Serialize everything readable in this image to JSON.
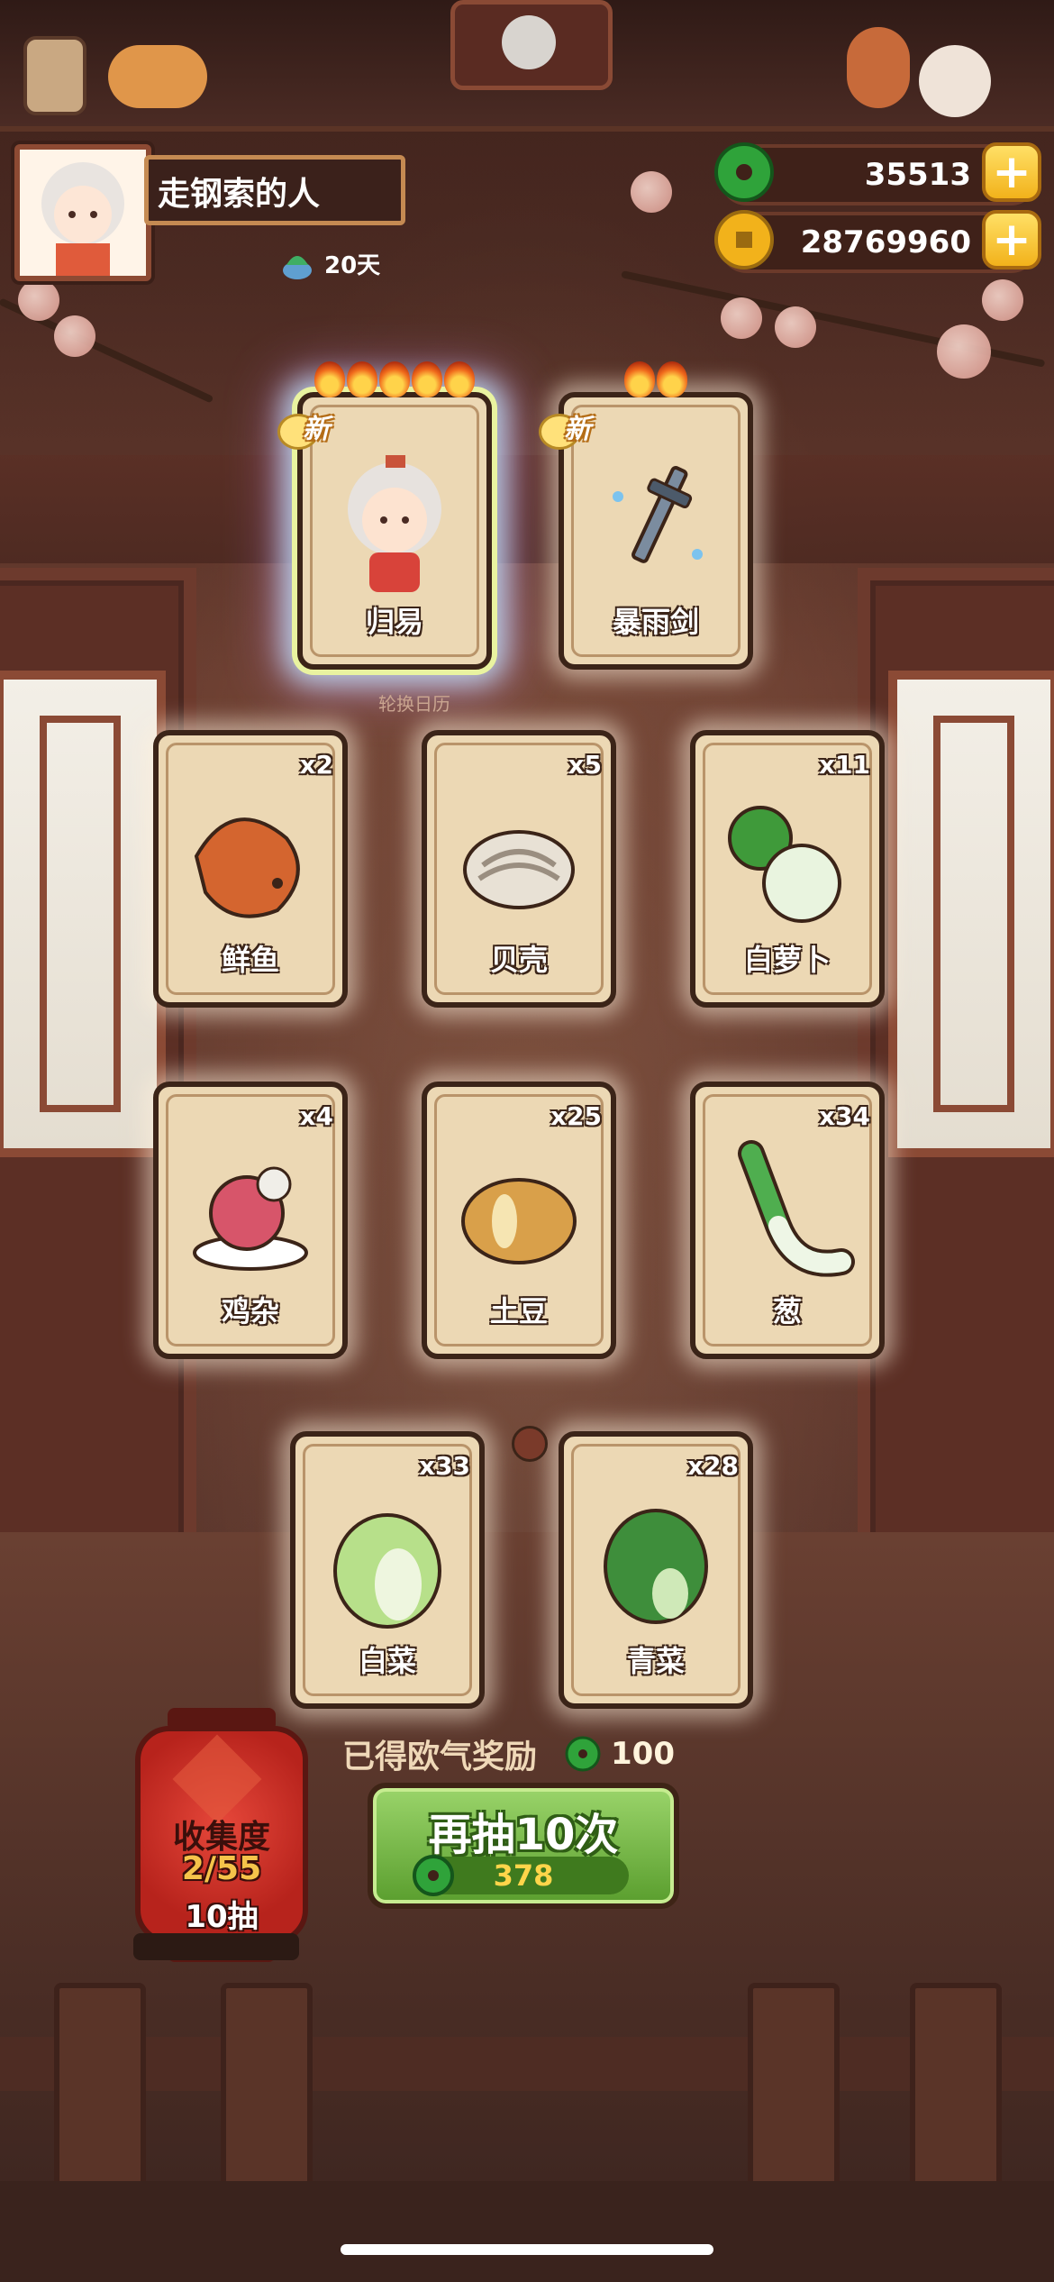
{
  "player": {
    "name": "走钢索的人",
    "days": "20天"
  },
  "currency": {
    "jade": "35513",
    "coins": "28769960"
  },
  "featured_cards": [
    {
      "label": "归易",
      "flames": 5,
      "badge": "新"
    },
    {
      "label": "暴雨剑",
      "flames": 2,
      "badge": "新"
    }
  ],
  "calendar_label": "轮换日历",
  "item_cards": [
    {
      "label": "鲜鱼",
      "count": "x2"
    },
    {
      "label": "贝壳",
      "count": "x5"
    },
    {
      "label": "白萝卜",
      "count": "x11"
    },
    {
      "label": "鸡杂",
      "count": "x4"
    },
    {
      "label": "土豆",
      "count": "x25"
    },
    {
      "label": "葱",
      "count": "x34"
    },
    {
      "label": "白菜",
      "count": "x33"
    },
    {
      "label": "青菜",
      "count": "x28"
    }
  ],
  "reward": {
    "label": "已得欧气奖励",
    "amount": "100"
  },
  "collection": {
    "title": "收集度",
    "progress": "2/55",
    "draws": "10抽"
  },
  "draw_button": {
    "label": "再抽10次",
    "cost": "378"
  },
  "colors": {
    "jade": "#2fa33a",
    "coin": "#f2b21b",
    "button_green": "#6fb33e",
    "lantern_red": "#c92b22"
  }
}
